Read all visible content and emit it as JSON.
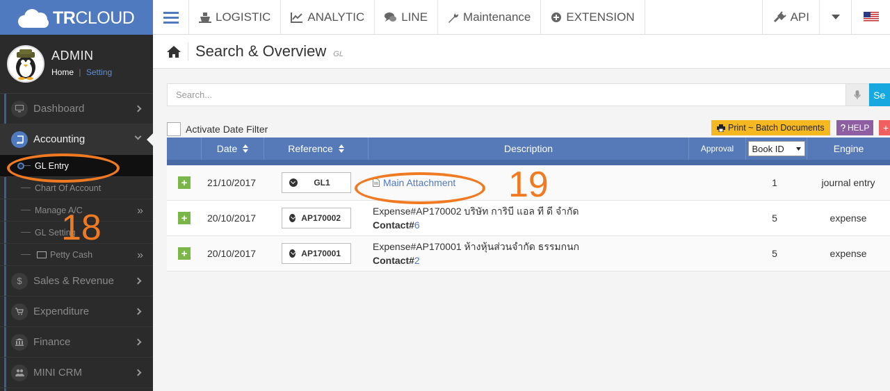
{
  "brand": {
    "logo_text_bold": "TR",
    "logo_text_light": "CLOUD"
  },
  "topnav": {
    "items": [
      {
        "label": "LOGISTIC",
        "icon": "ship-icon"
      },
      {
        "label": "ANALYTIC",
        "icon": "line-chart-icon"
      },
      {
        "label": "LINE",
        "icon": "comments-icon"
      },
      {
        "label": "Maintenance",
        "icon": "wrench-icon"
      },
      {
        "label": "EXTENSION",
        "icon": "plus-circle-icon"
      }
    ],
    "api_label": "API"
  },
  "profile": {
    "name": "ADMIN",
    "home_link": "Home",
    "separator": "|",
    "setting_link": "Setting"
  },
  "sidebar": {
    "items": [
      {
        "label": "Dashboard"
      },
      {
        "label": "Accounting"
      },
      {
        "label": "Sales & Revenue"
      },
      {
        "label": "Expenditure"
      },
      {
        "label": "Finance"
      },
      {
        "label": "MINI CRM"
      }
    ],
    "sub_items": [
      {
        "label": "GL Entry"
      },
      {
        "label": "Chart Of Account"
      },
      {
        "label": "Manage A/C"
      },
      {
        "label": "GL Setting"
      },
      {
        "label": "Petty Cash"
      }
    ]
  },
  "page": {
    "title": "Search & Overview",
    "subtitle": "GL"
  },
  "search": {
    "placeholder": "Search...",
    "button_label": "Se"
  },
  "filter": {
    "date_filter_label": "Activate Date Filter"
  },
  "actions": {
    "print_label": "Print ~ Batch Documents",
    "help_label": "HELP",
    "add_label": "+"
  },
  "table": {
    "headers": {
      "date": "Date",
      "reference": "Reference",
      "description": "Description",
      "approval": "Approval",
      "book_select": "Book ID",
      "engine": "Engine"
    },
    "rows": [
      {
        "date": "21/10/2017",
        "ref": "GL1",
        "desc_link": "Main Attachment",
        "desc_line1": "",
        "contact_label": "",
        "contact_id": "",
        "book": "1",
        "engine": "journal entry"
      },
      {
        "date": "20/10/2017",
        "ref": "AP170002",
        "desc_link": "",
        "desc_line1": "Expense#AP170002 บริษัท การิบี แอล ที ดี จำกัด",
        "contact_label": "Contact#",
        "contact_id": "6",
        "book": "5",
        "engine": "expense"
      },
      {
        "date": "20/10/2017",
        "ref": "AP170001",
        "desc_link": "",
        "desc_line1": "Expense#AP170001 ห้างหุ้นส่วนจำกัด ธรรมกนก",
        "contact_label": "Contact#",
        "contact_id": "2",
        "book": "5",
        "engine": "expense"
      }
    ]
  },
  "annotations": {
    "label_18": "18",
    "label_19": "19",
    "color": "#f07a22"
  }
}
